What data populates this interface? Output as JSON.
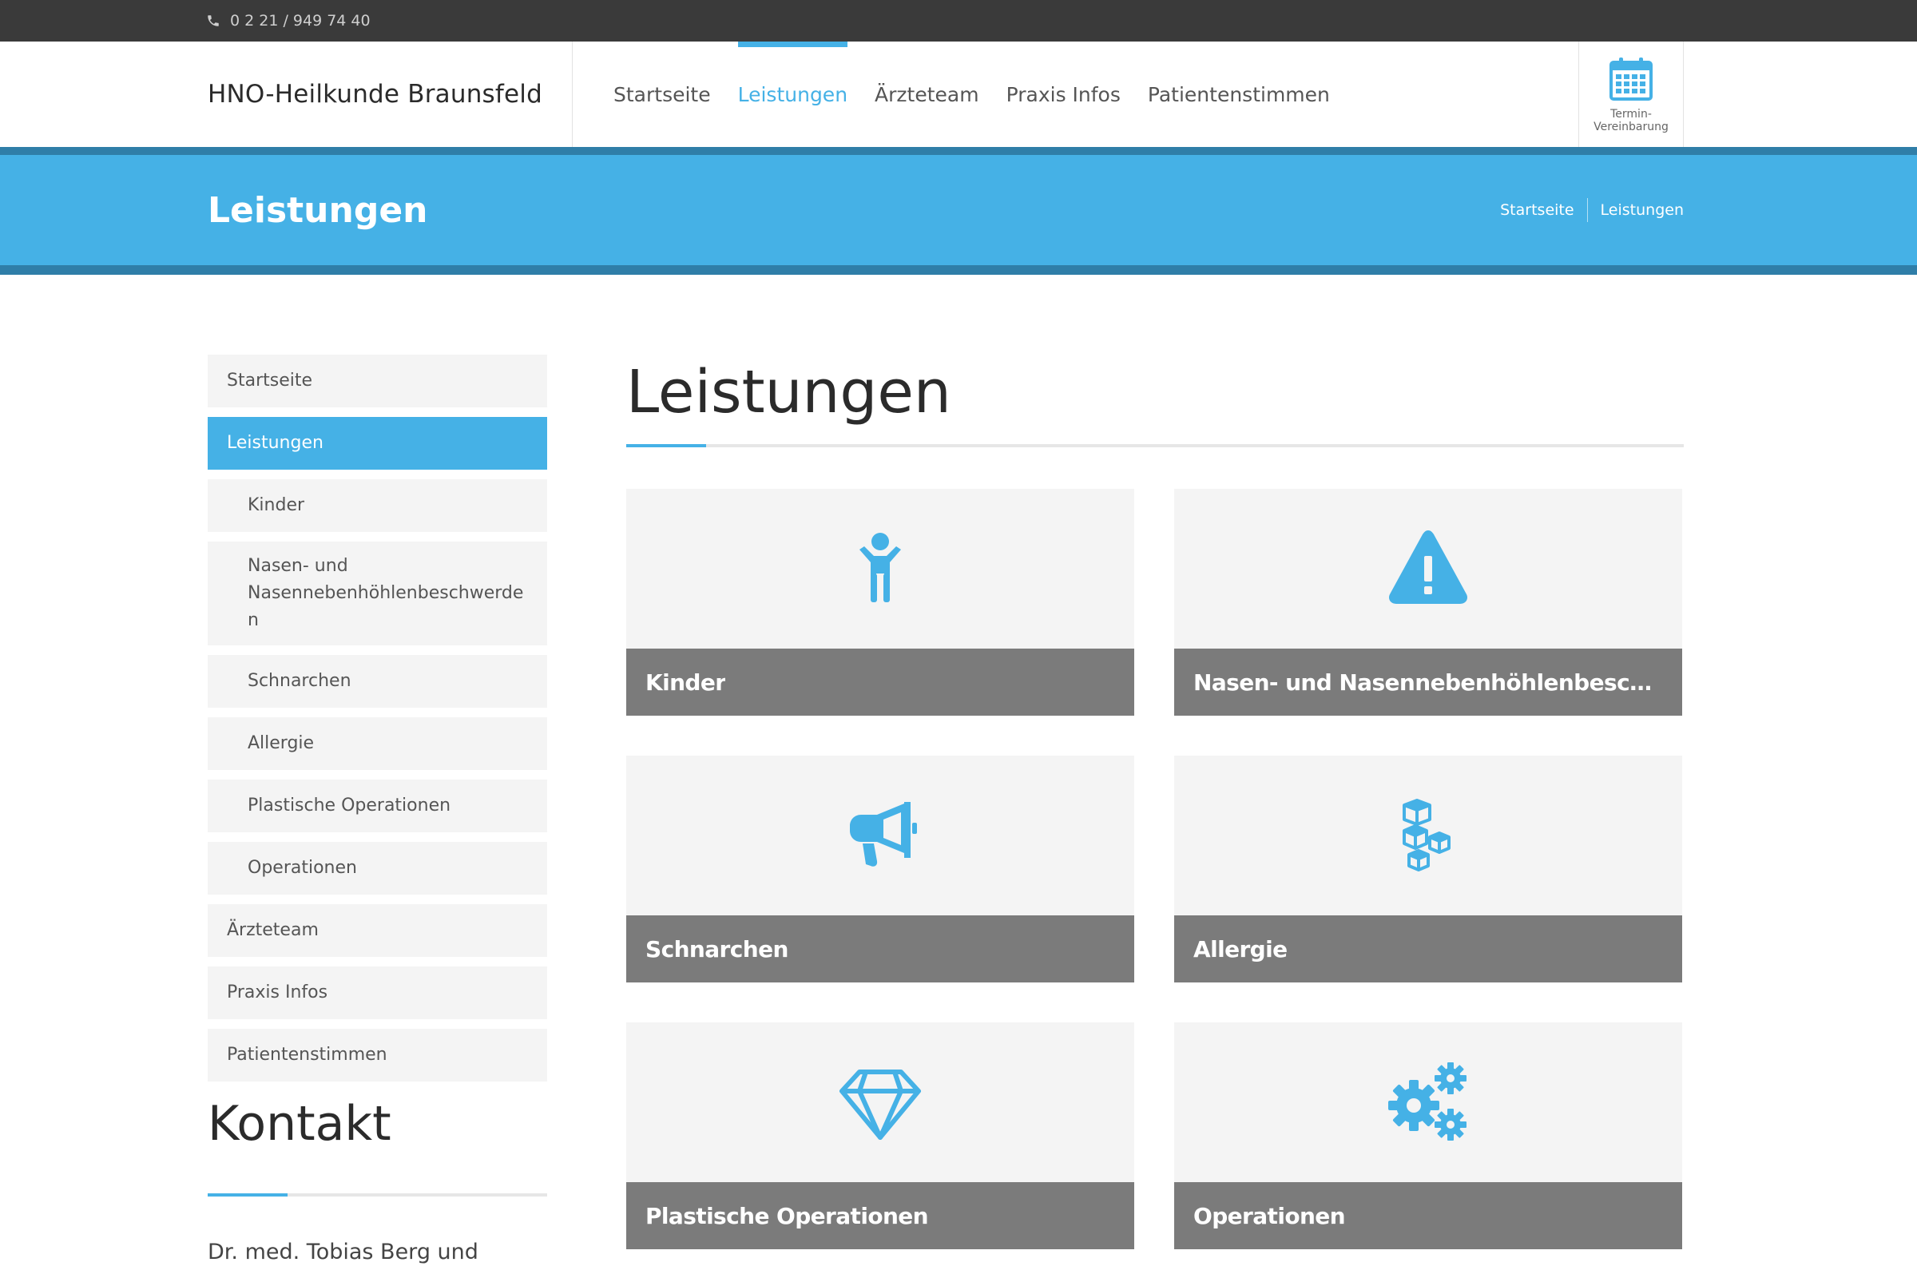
{
  "topbar": {
    "phone": "0 2 21 / 949 74 40"
  },
  "header": {
    "brand": "HNO-Heilkunde Braunsfeld",
    "nav": [
      {
        "label": "Startseite",
        "active": false
      },
      {
        "label": "Leistungen",
        "active": true
      },
      {
        "label": "Ärzteteam",
        "active": false
      },
      {
        "label": "Praxis Infos",
        "active": false
      },
      {
        "label": "Patientenstimmen",
        "active": false
      }
    ],
    "termin_line1": "Termin-",
    "termin_line2": "Vereinbarung"
  },
  "banner": {
    "title": "Leistungen",
    "breadcrumb": [
      "Startseite",
      "Leistungen"
    ]
  },
  "sidebar": {
    "items": [
      {
        "label": "Startseite"
      },
      {
        "label": "Leistungen"
      },
      {
        "label": "Kinder"
      },
      {
        "label": "Nasen- und Nasennebenhöhlenbeschwerden"
      },
      {
        "label": "Schnarchen"
      },
      {
        "label": "Allergie"
      },
      {
        "label": "Plastische Operationen"
      },
      {
        "label": "Operationen"
      },
      {
        "label": "Ärzteteam"
      },
      {
        "label": "Praxis Infos"
      },
      {
        "label": "Patientenstimmen"
      }
    ]
  },
  "kontakt": {
    "title": "Kontakt",
    "name": "Dr. med. Tobias Berg und"
  },
  "main": {
    "title": "Leistungen",
    "cards": [
      {
        "label": "Kinder",
        "icon": "child-icon"
      },
      {
        "label": "Nasen- und Nasennebenhöhlenbeschwerd...",
        "icon": "warning-icon"
      },
      {
        "label": "Schnarchen",
        "icon": "megaphone-icon"
      },
      {
        "label": "Allergie",
        "icon": "cubes-icon"
      },
      {
        "label": "Plastische Operationen",
        "icon": "diamond-icon"
      },
      {
        "label": "Operationen",
        "icon": "gears-icon"
      }
    ]
  },
  "colors": {
    "accent": "#45b1e6",
    "accent_dark": "#2f7ea8",
    "topbar": "#3a3a3a",
    "caption_bg": "#7b7b7b",
    "card_bg": "#f4f4f4"
  }
}
